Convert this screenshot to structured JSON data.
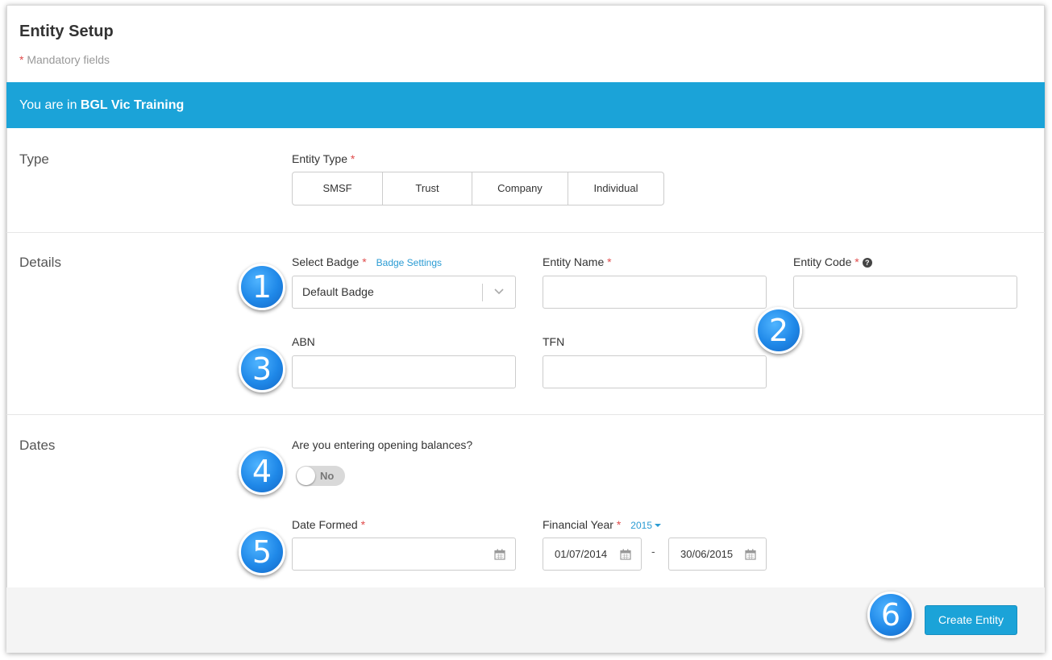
{
  "header": {
    "title": "Entity Setup",
    "mandatory_star": "*",
    "mandatory_note": "Mandatory fields"
  },
  "banner": {
    "prefix": "You are in",
    "entity": "BGL Vic Training"
  },
  "sections": {
    "type": "Type",
    "details": "Details",
    "dates": "Dates"
  },
  "entity_type": {
    "label": "Entity Type",
    "options": [
      "SMSF",
      "Trust",
      "Company",
      "Individual"
    ]
  },
  "details": {
    "badge_label": "Select Badge",
    "badge_settings_link": "Badge Settings",
    "badge_value": "Default Badge",
    "entity_name_label": "Entity Name",
    "entity_code_label": "Entity Code",
    "abn_label": "ABN",
    "tfn_label": "TFN"
  },
  "dates": {
    "opening_question": "Are you entering opening balances?",
    "toggle_text": "No",
    "toggle_on": false,
    "date_formed_label": "Date Formed",
    "financial_year_label": "Financial Year",
    "financial_year_value": "2015",
    "fy_start": "01/07/2014",
    "fy_separator": "-",
    "fy_end": "30/06/2015"
  },
  "footer": {
    "create_button": "Create Entity"
  },
  "required_mark": "*",
  "markers": [
    "1",
    "2",
    "3",
    "4",
    "5",
    "6"
  ],
  "colors": {
    "accent": "#1ba3d8",
    "required": "#e04b4b",
    "link": "#2a9bd3",
    "marker": "#1f88e8"
  }
}
